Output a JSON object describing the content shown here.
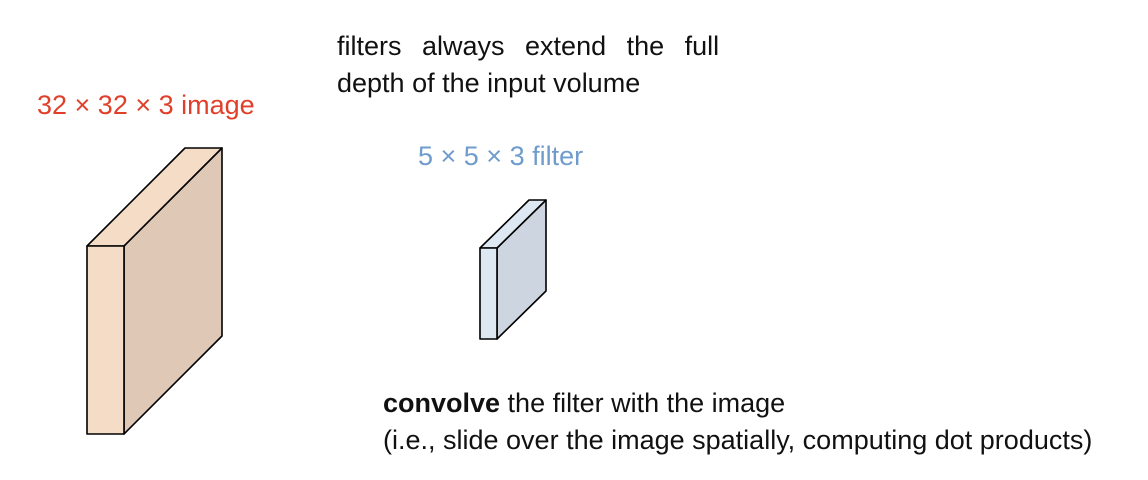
{
  "image_volume": {
    "label": "32 × 32 × 3 image",
    "label_color": "#e0402a",
    "front_color": "#f5dcc6",
    "side_color": "#dfc8b6",
    "top_color": "#f5dcc6",
    "stroke_color": "#000000"
  },
  "filter_volume": {
    "label": "5 × 5 × 3 filter",
    "label_color": "#6f9ccc",
    "front_color": "#dde8f2",
    "side_color": "#cdd6e0",
    "top_color": "#dde8f2",
    "stroke_color": "#000000"
  },
  "note": {
    "line1": "filters always extend the full",
    "line2": "depth of the input volume"
  },
  "convolve": {
    "bold_word": "convolve",
    "line1_rest": " the filter with the image",
    "line2": "(i.e., slide over the image spatially, computing dot products)"
  }
}
